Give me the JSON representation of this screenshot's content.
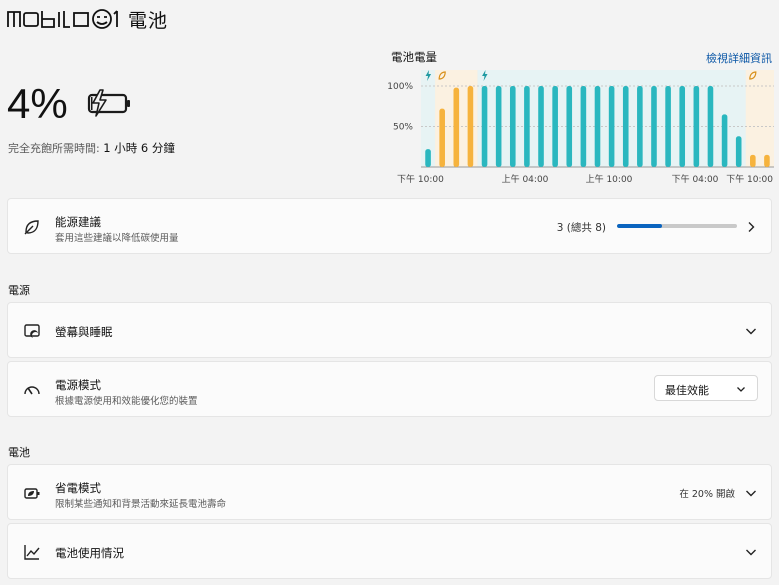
{
  "logo": {
    "wordmark": "mobile01",
    "text": "電池"
  },
  "battery": {
    "percent": "4%",
    "full_charge_label": "完全充飽所需時間:",
    "full_charge_value": "1 小時 6 分鐘",
    "level": 0.04
  },
  "chart": {
    "title": "電池電量",
    "link": "檢視詳細資訊"
  },
  "chart_data": {
    "type": "bar",
    "title": "電池電量",
    "ylim": [
      0,
      100
    ],
    "yticks": [
      "100%",
      "50%"
    ],
    "x_tick_labels": [
      "下午 10:00",
      "上午 04:00",
      "上午 10:00",
      "下午 04:00",
      "下午 10:00"
    ],
    "values": [
      22,
      72,
      98,
      100,
      100,
      100,
      100,
      100,
      100,
      100,
      100,
      100,
      100,
      100,
      100,
      100,
      100,
      100,
      100,
      100,
      100,
      65,
      38,
      15,
      15
    ],
    "series_state": [
      "charging",
      "saver",
      "saver",
      "saver",
      "charging",
      "charging",
      "charging",
      "charging",
      "charging",
      "charging",
      "charging",
      "charging",
      "charging",
      "charging",
      "charging",
      "charging",
      "charging",
      "charging",
      "charging",
      "charging",
      "charging",
      "charging",
      "charging",
      "saver",
      "saver"
    ],
    "colors": {
      "charging": "#2ab7bf",
      "saver": "#f6b33d"
    },
    "grid": true
  },
  "recommendations": {
    "title": "能源建議",
    "subtitle": "套用這些建議以降低碳使用量",
    "value": "3 (總共 8)",
    "progress": 0.375
  },
  "power_section": "電源",
  "screen_sleep": {
    "title": "螢幕與睡眠"
  },
  "power_mode": {
    "title": "電源模式",
    "subtitle": "根據電源使用和效能優化您的裝置",
    "selected": "最佳效能"
  },
  "battery_section": "電池",
  "battery_saver": {
    "title": "省電模式",
    "subtitle": "限制某些通知和背景活動來延長電池壽命",
    "value": "在 20% 開啟"
  },
  "battery_usage": {
    "title": "電池使用情況"
  }
}
